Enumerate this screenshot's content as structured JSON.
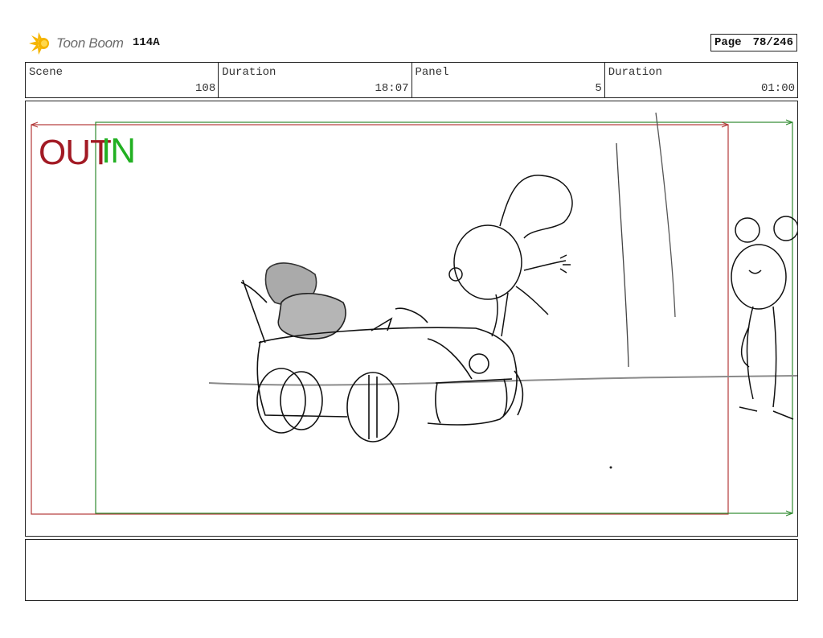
{
  "header": {
    "logo_text": "Toon Boom",
    "project": "114A",
    "page_label": "Page",
    "page_value": "78/246"
  },
  "info": {
    "scene_label": "Scene",
    "scene_value": "108",
    "scene_duration_label": "Duration",
    "scene_duration_value": "18:07",
    "panel_label": "Panel",
    "panel_value": "5",
    "panel_duration_label": "Duration",
    "panel_duration_value": "01:00"
  },
  "frame": {
    "out_label": "OUT",
    "in_label": "IN",
    "out_color": "#a21a24",
    "in_color": "#22b022"
  },
  "notes": {
    "text": ""
  }
}
